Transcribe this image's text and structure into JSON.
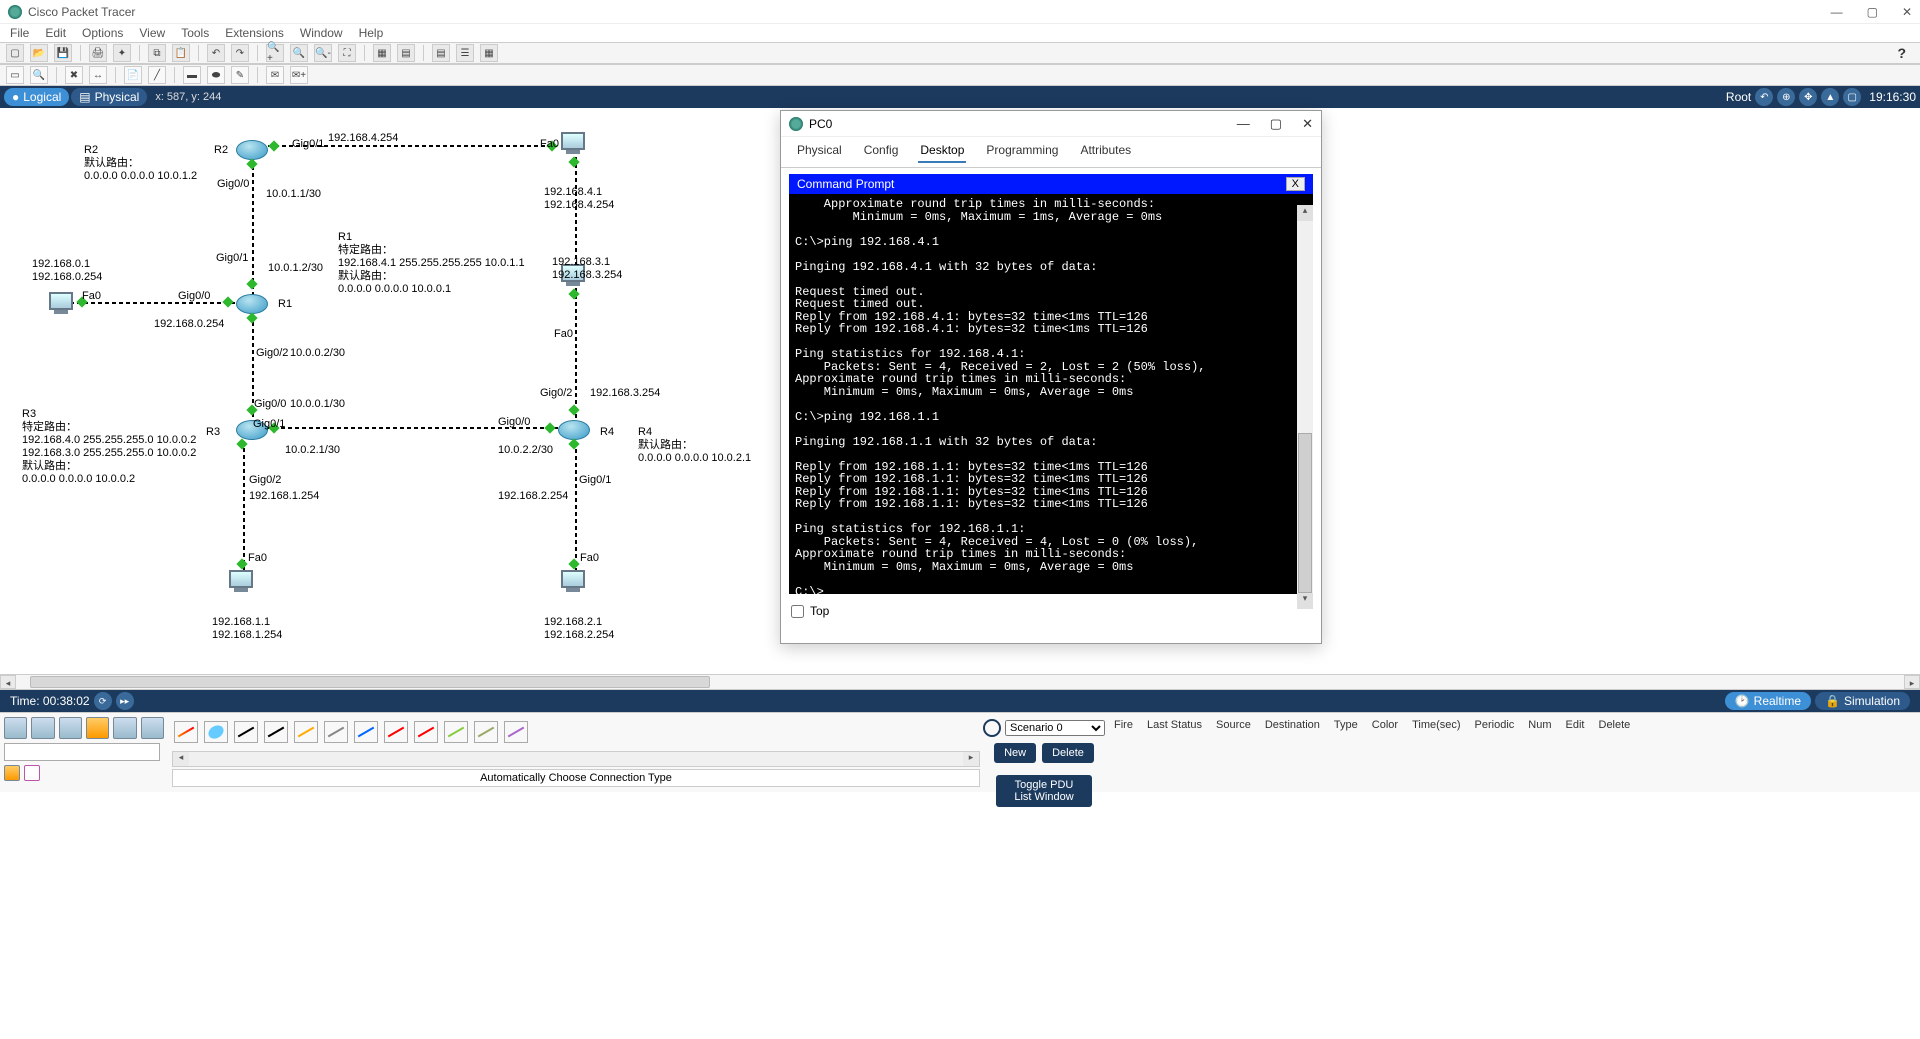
{
  "title": "Cisco Packet Tracer",
  "menu": [
    "File",
    "Edit",
    "Options",
    "View",
    "Tools",
    "Extensions",
    "Window",
    "Help"
  ],
  "viewtabs": {
    "logical": "Logical",
    "physical": "Physical"
  },
  "coords": "x: 587, y: 244",
  "root_label": "Root",
  "clock": "19:16:30",
  "time_label": "Time: 00:38:02",
  "mode": {
    "realtime": "Realtime",
    "simulation": "Simulation"
  },
  "scenario": {
    "option": "Scenario 0",
    "new": "New",
    "delete": "Delete",
    "toggle": "Toggle PDU List Window"
  },
  "pdu_headers": [
    "Fire",
    "Last Status",
    "Source",
    "Destination",
    "Type",
    "Color",
    "Time(sec)",
    "Periodic",
    "Num",
    "Edit",
    "Delete"
  ],
  "cable_hint": "Automatically Choose Connection Type",
  "notes": {
    "r2": "R2\n默认路由：\n0.0.0.0 0.0.0.0 10.0.1.2",
    "r1": "R1\n特定路由：\n192.168.4.1 255.255.255.255 10.0.1.1\n默认路由：\n0.0.0.0 0.0.0.0 10.0.0.1",
    "r3": "R3\n特定路由：\n192.168.4.0 255.255.255.0 10.0.0.2\n192.168.3.0 255.255.255.0 10.0.0.2\n默认路由：\n0.0.0.0 0.0.0.0 10.0.0.2",
    "r4": "R4\n默认路由：\n0.0.0.0 0.0.0.0 10.0.2.1"
  },
  "labels": {
    "R2": "R2",
    "R1": "R1",
    "R3": "R3",
    "R4": "R4",
    "gig01_a": "Gig0/1",
    "gig00_a": "Gig0/0",
    "gig01_b": "Gig0/1",
    "gig00_b": "Gig0/0",
    "gig02_b": "Gig0/2",
    "gig00_c": "Gig0/0",
    "gig01_c": "Gig0/1",
    "gig02_c": "Gig0/2",
    "gig00_d": "Gig0/0",
    "gig02_d": "Gig0/2",
    "gig01_d": "Gig0/1",
    "fa0_1": "Fa0",
    "fa0_2": "Fa0",
    "fa0_3": "Fa0",
    "fa0_4": "Fa0",
    "fa0_5": "Fa0",
    "fa0_6": "Fa0",
    "ip_4_254": "192.168.4.254",
    "ip_10_0_1_1": "10.0.1.1/30",
    "ip_10_0_1_2": "10.0.1.2/30",
    "ip_10_0_0_2": "10.0.0.2/30",
    "ip_10_0_0_1": "10.0.0.1/30",
    "ip_10_0_2_1": "10.0.2.1/30",
    "ip_10_0_2_2": "10.0.2.2/30",
    "ip_0_254": "192.168.0.254",
    "ip_1_254": "192.168.1.254",
    "ip_2_254": "192.168.2.254",
    "ip_3_254": "192.168.3.254",
    "pc_topright": "192.168.4.1\n192.168.4.254",
    "pc_midright": "192.168.3.1\n192.168.3.254",
    "pc_left": "192.168.0.1\n192.168.0.254",
    "pc_botleft": "192.168.1.1\n192.168.1.254",
    "pc_botright": "192.168.2.1\n192.168.2.254"
  },
  "dialog": {
    "title": "PC0",
    "tabs": [
      "Physical",
      "Config",
      "Desktop",
      "Programming",
      "Attributes"
    ],
    "active_tab": "Desktop",
    "cmd_title": "Command Prompt",
    "cmd_close": "X",
    "top_checkbox": "Top",
    "terminal": "    Approximate round trip times in milli-seconds:\n        Minimum = 0ms, Maximum = 1ms, Average = 0ms\n\nC:\\>ping 192.168.4.1\n\nPinging 192.168.4.1 with 32 bytes of data:\n\nRequest timed out.\nRequest timed out.\nReply from 192.168.4.1: bytes=32 time<1ms TTL=126\nReply from 192.168.4.1: bytes=32 time<1ms TTL=126\n\nPing statistics for 192.168.4.1:\n    Packets: Sent = 4, Received = 2, Lost = 2 (50% loss),\nApproximate round trip times in milli-seconds:\n    Minimum = 0ms, Maximum = 0ms, Average = 0ms\n\nC:\\>ping 192.168.1.1\n\nPinging 192.168.1.1 with 32 bytes of data:\n\nReply from 192.168.1.1: bytes=32 time<1ms TTL=126\nReply from 192.168.1.1: bytes=32 time<1ms TTL=126\nReply from 192.168.1.1: bytes=32 time<1ms TTL=126\nReply from 192.168.1.1: bytes=32 time<1ms TTL=126\n\nPing statistics for 192.168.1.1:\n    Packets: Sent = 4, Received = 4, Lost = 0 (0% loss),\nApproximate round trip times in milli-seconds:\n    Minimum = 0ms, Maximum = 0ms, Average = 0ms\n\nC:\\>"
  }
}
